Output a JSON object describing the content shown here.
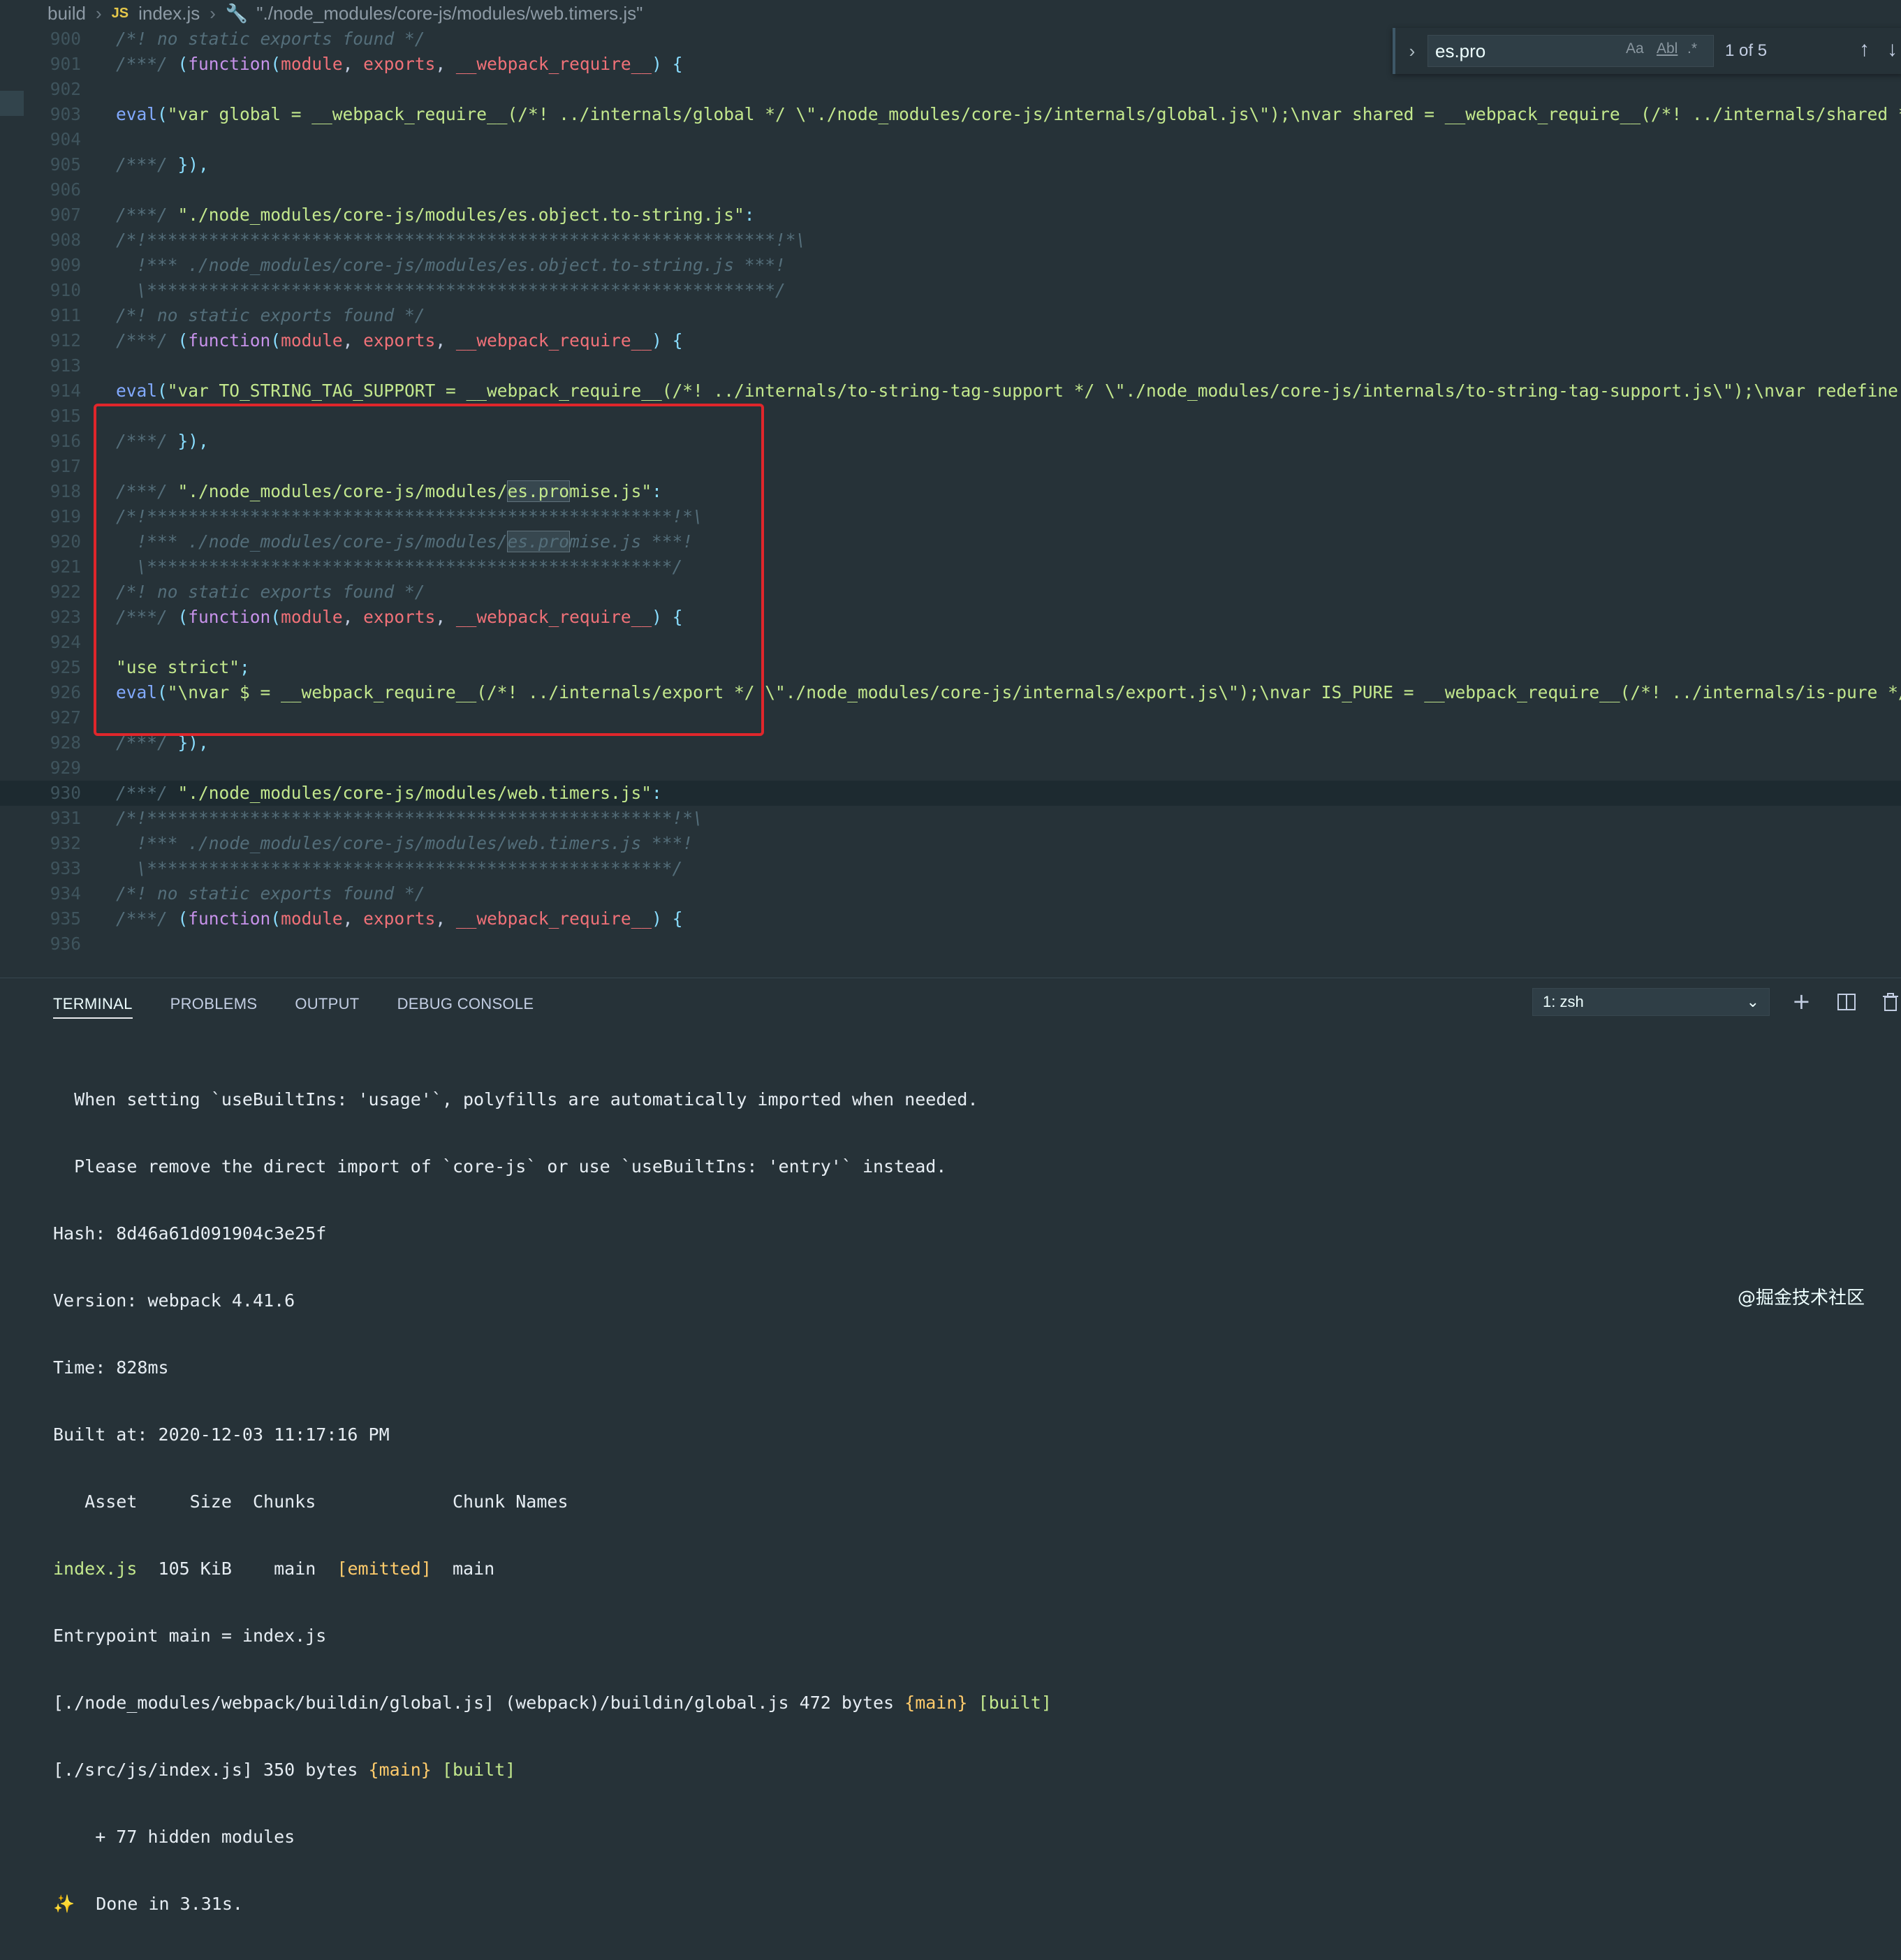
{
  "breadcrumb": {
    "folder": "build",
    "file": "index.js",
    "file_badge": "JS",
    "symbol": "\"./node_modules/core-js/modules/web.timers.js\""
  },
  "find": {
    "query": "es.pro",
    "match_case": "Aa",
    "whole_word": "Abl",
    "regex": ".*",
    "count": "1 of 5",
    "toggle_icon": "chevron-right-icon",
    "prev_icon": "arrow-up-icon",
    "next_icon": "arrow-down-icon"
  },
  "editor": {
    "current_line": "930",
    "lines": [
      {
        "n": "900",
        "code": "/*! no static exports found */"
      },
      {
        "n": "901",
        "code": "/***/ (function(module, exports, __webpack_require__) {"
      },
      {
        "n": "902",
        "code": ""
      },
      {
        "n": "903",
        "code": "eval(\"var global = __webpack_require__(/*! ../internals/global */ \\\"./node_modules/core-js/internals/global.js\\\");\\nvar shared = __webpack_require__(/*! ../internals/shared */ \\\"./no"
      },
      {
        "n": "904",
        "code": ""
      },
      {
        "n": "905",
        "code": "/***/ }),"
      },
      {
        "n": "906",
        "code": ""
      },
      {
        "n": "907",
        "code": "/***/ \"./node_modules/core-js/modules/es.object.to-string.js\":"
      },
      {
        "n": "908",
        "code": "/*!*************************************************************!*\\"
      },
      {
        "n": "909",
        "code": "  !*** ./node_modules/core-js/modules/es.object.to-string.js ***!"
      },
      {
        "n": "910",
        "code": "  \\*************************************************************/"
      },
      {
        "n": "911",
        "code": "/*! no static exports found */"
      },
      {
        "n": "912",
        "code": "/***/ (function(module, exports, __webpack_require__) {"
      },
      {
        "n": "913",
        "code": ""
      },
      {
        "n": "914",
        "code": "eval(\"var TO_STRING_TAG_SUPPORT = __webpack_require__(/*! ../internals/to-string-tag-support */ \\\"./node_modules/core-js/internals/to-string-tag-support.js\\\");\\nvar redefine = __webp"
      },
      {
        "n": "915",
        "code": ""
      },
      {
        "n": "916",
        "code": "/***/ }),"
      },
      {
        "n": "917",
        "code": ""
      },
      {
        "n": "918",
        "code": "/***/ \"./node_modules/core-js/modules/es.promise.js\":"
      },
      {
        "n": "919",
        "code": "/*!***************************************************!*\\"
      },
      {
        "n": "920",
        "code": "  !*** ./node_modules/core-js/modules/es.promise.js ***!"
      },
      {
        "n": "921",
        "code": "  \\***************************************************/"
      },
      {
        "n": "922",
        "code": "/*! no static exports found */"
      },
      {
        "n": "923",
        "code": "/***/ (function(module, exports, __webpack_require__) {"
      },
      {
        "n": "924",
        "code": ""
      },
      {
        "n": "925",
        "code": "\"use strict\";"
      },
      {
        "n": "926",
        "code": "eval(\"\\nvar $ = __webpack_require__(/*! ../internals/export */ \\\"./node_modules/core-js/internals/export.js\\\");\\nvar IS_PURE = __webpack_require__(/*! ../internals/is-pure */ \\\"./nod"
      },
      {
        "n": "927",
        "code": ""
      },
      {
        "n": "928",
        "code": "/***/ }),"
      },
      {
        "n": "929",
        "code": ""
      },
      {
        "n": "930",
        "code": "/***/ \"./node_modules/core-js/modules/web.timers.js\":"
      },
      {
        "n": "931",
        "code": "/*!***************************************************!*\\"
      },
      {
        "n": "932",
        "code": "  !*** ./node_modules/core-js/modules/web.timers.js ***!"
      },
      {
        "n": "933",
        "code": "  \\***************************************************/"
      },
      {
        "n": "934",
        "code": "/*! no static exports found */"
      },
      {
        "n": "935",
        "code": "/***/ (function(module, exports, __webpack_require__) {"
      },
      {
        "n": "936",
        "code": ""
      }
    ]
  },
  "panel": {
    "tabs": [
      "TERMINAL",
      "PROBLEMS",
      "OUTPUT",
      "DEBUG CONSOLE"
    ],
    "active_tab": "TERMINAL",
    "shell": "1: zsh",
    "add_icon": "plus-icon",
    "split_icon": "split-icon",
    "trash_icon": "trash-icon"
  },
  "terminal": {
    "lines": [
      "  When setting `useBuiltIns: 'usage'`, polyfills are automatically imported when needed.",
      "  Please remove the direct import of `core-js` or use `useBuiltIns: 'entry'` instead.",
      "Hash: 8d46a61d091904c3e25f",
      "Version: webpack 4.41.6",
      "Time: 828ms",
      "Built at: 2020-12-03 11:17:16 PM",
      "   Asset     Size  Chunks             Chunk Names"
    ],
    "asset_row": {
      "asset": "index.js",
      "size": "  105 KiB",
      "chunks": "    main",
      "emitted": "  [emitted]",
      "names": "  main"
    },
    "entrypoint": "Entrypoint main = index.js",
    "built_lines": [
      {
        "path": "[./node_modules/webpack/buildin/global.js] (webpack)/buildin/global.js 472 bytes ",
        "chunk": "{main}",
        "status": " [built]"
      },
      {
        "path": "[./src/js/index.js] 350 bytes ",
        "chunk": "{main}",
        "status": " [built]"
      }
    ],
    "hidden": "    + 77 hidden modules",
    "done_icon": "sparkles-icon",
    "done": "  Done in 3.31s."
  },
  "watermark": "@掘金技术社区",
  "colors": {
    "background": "#263238",
    "comment": "#546e7a",
    "string": "#c3e88d",
    "keyword": "#c792ea",
    "param": "#f07178",
    "function": "#82aaff",
    "highlight_box": "#e0262b"
  }
}
